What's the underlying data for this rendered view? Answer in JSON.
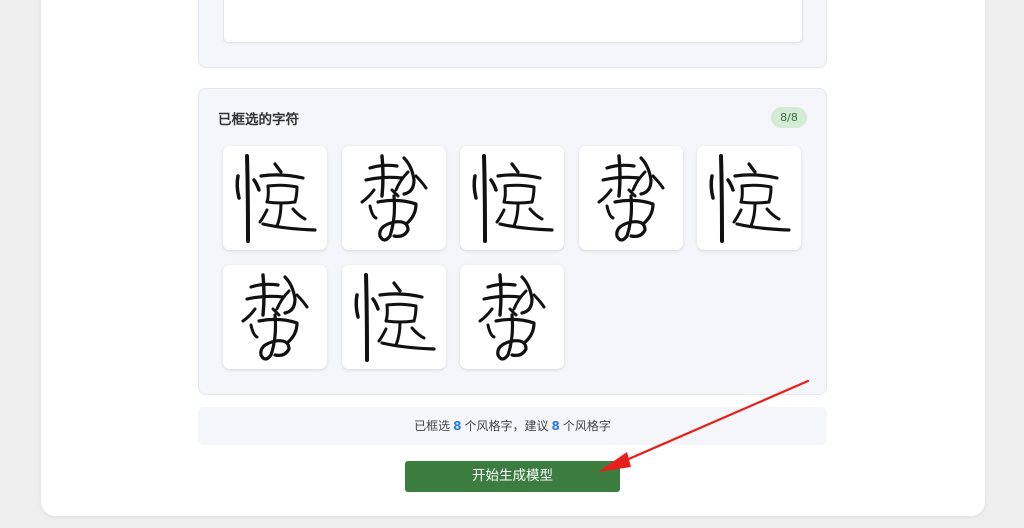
{
  "selected_panel": {
    "title": "已框选的字符",
    "badge": "8/8",
    "characters": [
      {
        "glyph": "惊"
      },
      {
        "glyph": "势"
      },
      {
        "glyph": "惊"
      },
      {
        "glyph": "势"
      },
      {
        "glyph": "惊"
      },
      {
        "glyph": "势"
      },
      {
        "glyph": "惊"
      },
      {
        "glyph": "势"
      }
    ]
  },
  "summary": {
    "prefix": "已框选",
    "selected_count": "8",
    "middle": "个风格字，建议",
    "suggested_count": "8",
    "suffix": "个风格字"
  },
  "actions": {
    "start_label": "开始生成模型"
  },
  "annotation": {
    "arrow_color": "#e8201c"
  }
}
